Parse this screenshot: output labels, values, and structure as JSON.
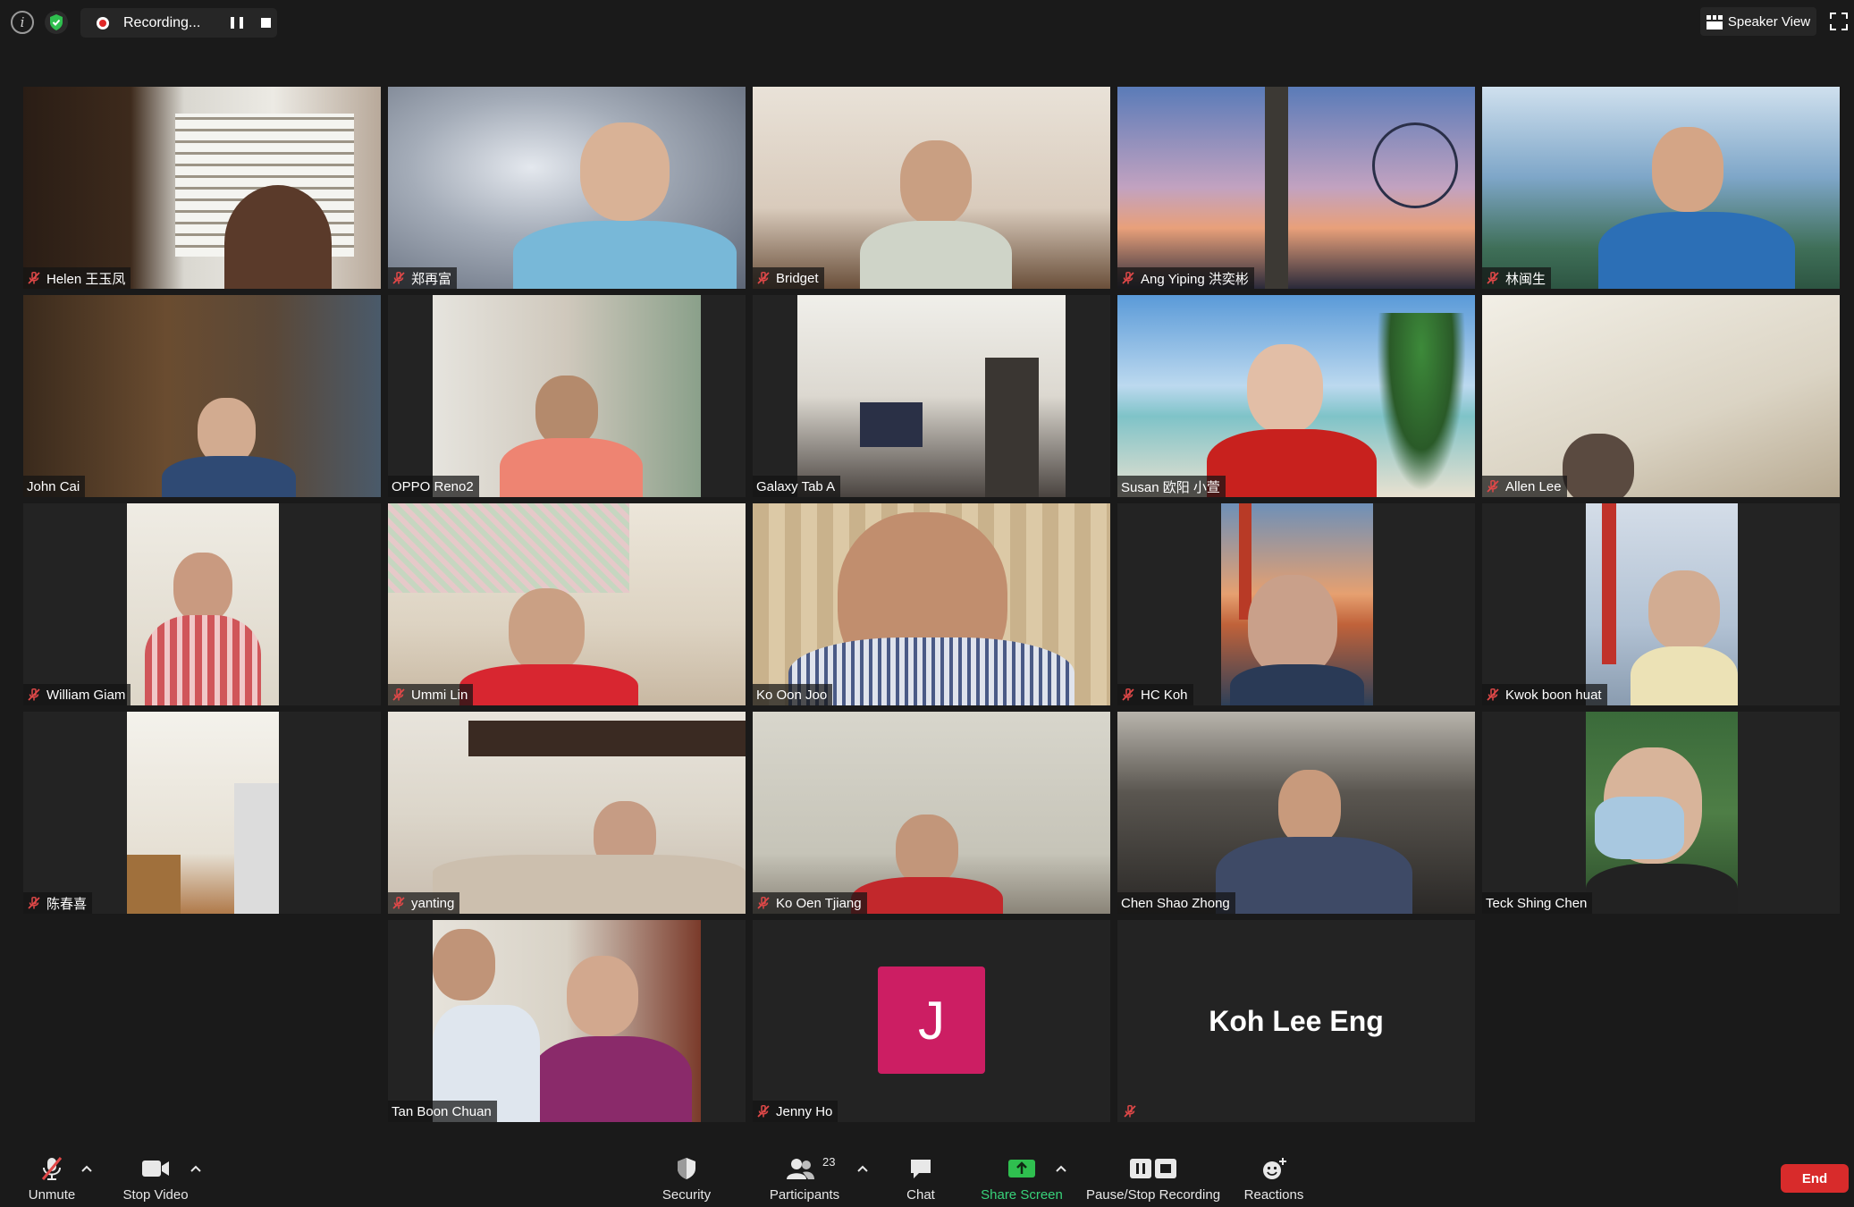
{
  "topbar": {
    "recording_label": "Recording...",
    "speaker_view_label": "Speaker View"
  },
  "tiles": [
    {
      "name": "Helen 王玉凤",
      "muted": true
    },
    {
      "name": "郑再富",
      "muted": true
    },
    {
      "name": "Bridget",
      "muted": true
    },
    {
      "name": "Ang Yiping 洪奕彬",
      "muted": true
    },
    {
      "name": "林闽生",
      "muted": true
    },
    {
      "name": "John Cai",
      "muted": false
    },
    {
      "name": "OPPO Reno2",
      "muted": false
    },
    {
      "name": "Galaxy Tab A",
      "muted": false
    },
    {
      "name": "Susan 欧阳 小萱",
      "muted": false
    },
    {
      "name": "Allen Lee",
      "muted": true
    },
    {
      "name": "William Giam",
      "muted": true
    },
    {
      "name": "Ummi Lin",
      "muted": true
    },
    {
      "name": "Ko Oon Joo",
      "muted": false,
      "active_speaker": true
    },
    {
      "name": "HC Koh",
      "muted": true
    },
    {
      "name": "Kwok boon huat",
      "muted": true
    },
    {
      "name": "陈春喜",
      "muted": true
    },
    {
      "name": "yanting",
      "muted": true
    },
    {
      "name": "Ko Oen Tjiang",
      "muted": true
    },
    {
      "name": "Chen Shao Zhong",
      "muted": false
    },
    {
      "name": "Teck Shing Chen",
      "muted": false
    },
    {
      "name": "Tan Boon Chuan",
      "muted": false
    },
    {
      "name": "Jenny Ho",
      "muted": true,
      "avatar_letter": "J"
    },
    {
      "name": "Koh Lee Eng",
      "muted": true,
      "video_off": true
    }
  ],
  "toolbar": {
    "unmute_label": "Unmute",
    "stop_video_label": "Stop Video",
    "security_label": "Security",
    "participants_label": "Participants",
    "participants_count": "23",
    "chat_label": "Chat",
    "share_screen_label": "Share Screen",
    "pause_stop_label": "Pause/Stop Recording",
    "reactions_label": "Reactions",
    "end_label": "End"
  },
  "colors": {
    "background": "#1a1a1a",
    "active_speaker_border": "#e2e35a",
    "muted_icon": "#e04848",
    "share_green": "#38d27a",
    "end_red": "#d82b2b",
    "avatar_magenta": "#cc1e63"
  }
}
